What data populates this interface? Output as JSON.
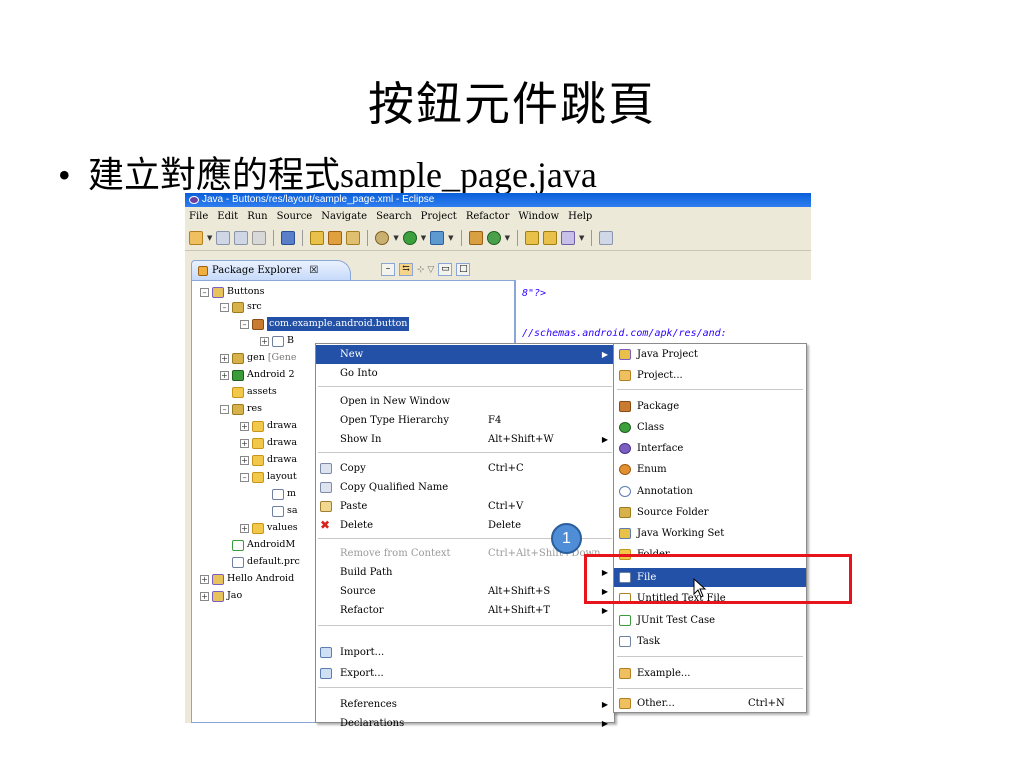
{
  "slide": {
    "title": "按鈕元件跳頁",
    "bullet_symbol": "•",
    "bullet_text": "建立對應的程式sample_page.java"
  },
  "eclipse": {
    "window_title": "Java - Buttons/res/layout/sample_page.xml - Eclipse",
    "menu": [
      "File",
      "Edit",
      "Run",
      "Source",
      "Navigate",
      "Search",
      "Project",
      "Refactor",
      "Window",
      "Help"
    ],
    "view_tab": {
      "label": "Package Explorer",
      "close": "☒"
    },
    "tree": {
      "buttons": "Buttons",
      "src": "src",
      "package": "com.example.android.button",
      "b_file": "B",
      "gen": "gen",
      "gen_suffix": "[Gene",
      "android2": "Android 2",
      "assets": "assets",
      "res": "res",
      "drawable1": "drawa",
      "drawable2": "drawa",
      "drawable3": "drawa",
      "layout": "layout",
      "layout_m": "m",
      "layout_sa": "sa",
      "values": "values",
      "manifest": "AndroidM",
      "default_prop": "default.prc",
      "hello": "Hello Android",
      "jao": "Jao"
    },
    "editor_lines": [
      "8\"?>",
      "//schemas.android.com/apk/res/and:"
    ],
    "context_menu": {
      "new": "New",
      "go_into": "Go Into",
      "open_new_window": "Open in New Window",
      "open_type_hierarchy": "Open Type Hierarchy",
      "open_type_hierarchy_key": "F4",
      "show_in": "Show In",
      "show_in_key": "Alt+Shift+W",
      "copy": "Copy",
      "copy_key": "Ctrl+C",
      "copy_qualified": "Copy Qualified Name",
      "paste": "Paste",
      "paste_key": "Ctrl+V",
      "delete": "Delete",
      "delete_key": "Delete",
      "remove_context": "Remove from Context",
      "remove_context_key": "Ctrl+Alt+Shift+Down",
      "build_path": "Build Path",
      "source": "Source",
      "source_key": "Alt+Shift+S",
      "refactor": "Refactor",
      "refactor_key": "Alt+Shift+T",
      "import": "Import...",
      "export": "Export...",
      "references": "References",
      "declarations": "Declarations"
    },
    "new_submenu": {
      "java_project": "Java Project",
      "project": "Project...",
      "package": "Package",
      "class": "Class",
      "interface": "Interface",
      "enum": "Enum",
      "annotation": "Annotation",
      "source_folder": "Source Folder",
      "java_working_set": "Java Working Set",
      "folder": "Folder",
      "file": "File",
      "untitled_text_file": "Untitled Text File",
      "junit_test_case": "JUnit Test Case",
      "task": "Task",
      "example": "Example...",
      "other": "Other...",
      "other_key": "Ctrl+N"
    }
  },
  "annotation": {
    "step": "1",
    "highlight_color": "#e8141c"
  }
}
